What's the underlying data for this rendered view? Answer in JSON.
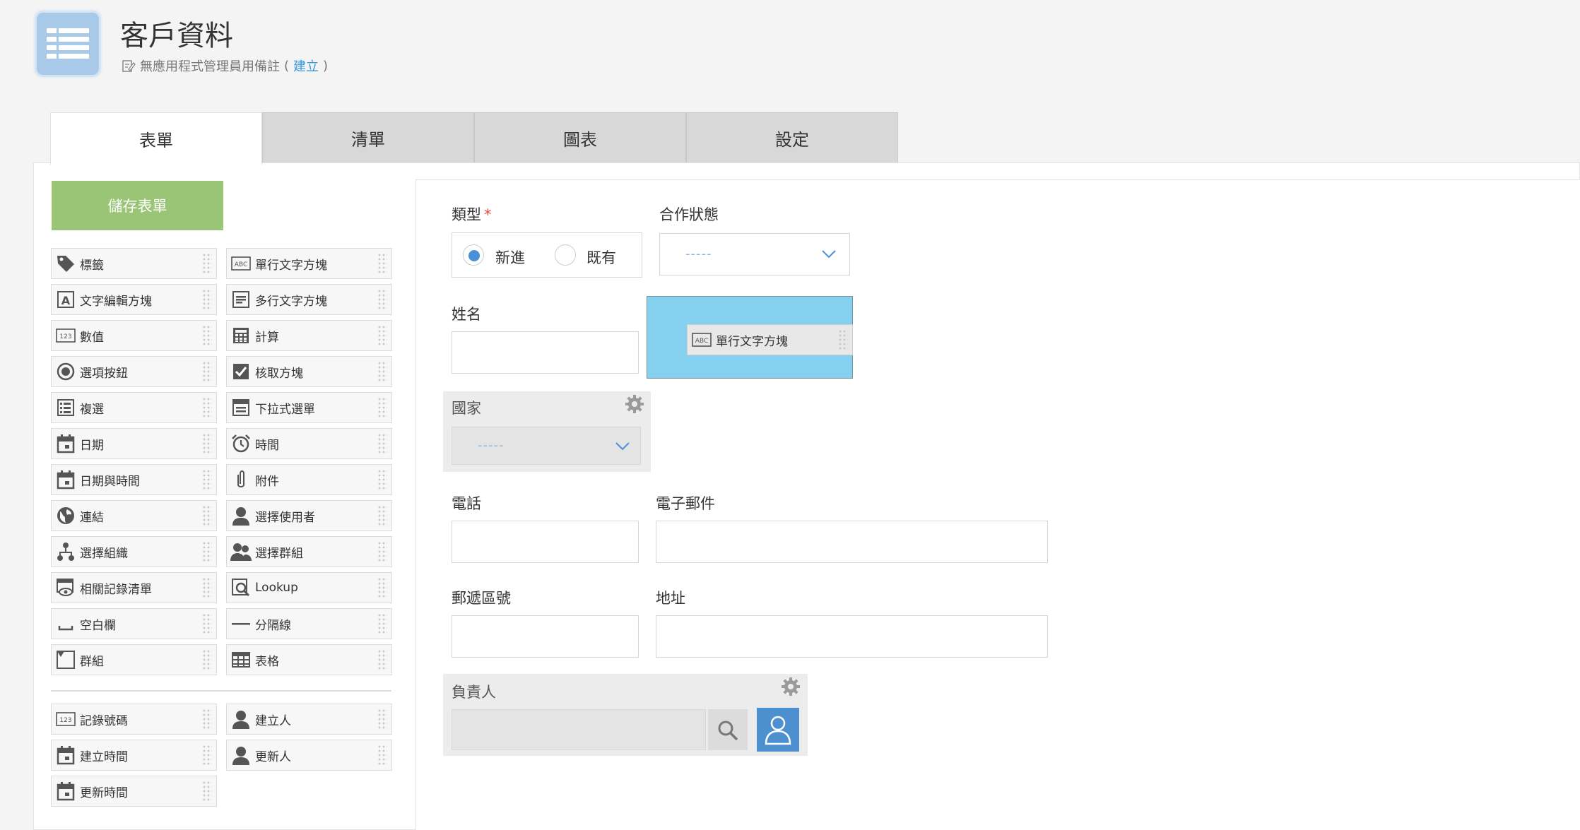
{
  "header": {
    "app_title": "客戶資料",
    "memo_text": "無應用程式管理員用備註",
    "memo_paren_open": "(",
    "memo_link": "建立",
    "memo_paren_close": ")"
  },
  "tabs": [
    {
      "label": "表單",
      "active": true
    },
    {
      "label": "清單",
      "active": false
    },
    {
      "label": "圖表",
      "active": false
    },
    {
      "label": "設定",
      "active": false
    }
  ],
  "save_button": "儲存表單",
  "palette": {
    "fields": [
      {
        "label": "標籤",
        "icon": "tag-icon"
      },
      {
        "label": "單行文字方塊",
        "icon": "abc-icon"
      },
      {
        "label": "文字編輯方塊",
        "icon": "rich-text-icon"
      },
      {
        "label": "多行文字方塊",
        "icon": "multiline-icon"
      },
      {
        "label": "數值",
        "icon": "number-icon"
      },
      {
        "label": "計算",
        "icon": "calculator-icon"
      },
      {
        "label": "選項按鈕",
        "icon": "radio-icon"
      },
      {
        "label": "核取方塊",
        "icon": "checkbox-icon"
      },
      {
        "label": "複選",
        "icon": "multi-select-icon"
      },
      {
        "label": "下拉式選單",
        "icon": "dropdown-icon"
      },
      {
        "label": "日期",
        "icon": "calendar-icon"
      },
      {
        "label": "時間",
        "icon": "alarm-clock-icon"
      },
      {
        "label": "日期與時間",
        "icon": "calendar-icon"
      },
      {
        "label": "附件",
        "icon": "paperclip-icon"
      },
      {
        "label": "連結",
        "icon": "globe-icon"
      },
      {
        "label": "選擇使用者",
        "icon": "user-icon"
      },
      {
        "label": "選擇組織",
        "icon": "org-icon"
      },
      {
        "label": "選擇群組",
        "icon": "group-icon"
      },
      {
        "label": "相關記錄清單",
        "icon": "related-records-icon"
      },
      {
        "label": "Lookup",
        "icon": "lookup-icon"
      },
      {
        "label": "空白欄",
        "icon": "blank-space-icon"
      },
      {
        "label": "分隔線",
        "icon": "divider-icon"
      },
      {
        "label": "群組",
        "icon": "group-field-icon"
      },
      {
        "label": "表格",
        "icon": "table-icon"
      }
    ],
    "system_fields": [
      {
        "label": "記錄號碼",
        "icon": "number-icon"
      },
      {
        "label": "建立人",
        "icon": "user-icon"
      },
      {
        "label": "建立時間",
        "icon": "calendar-icon"
      },
      {
        "label": "更新人",
        "icon": "user-icon"
      },
      {
        "label": "更新時間",
        "icon": "calendar-icon"
      }
    ]
  },
  "form": {
    "type_label": "類型",
    "type_required": "*",
    "type_options": [
      "新進",
      "既有"
    ],
    "type_selected": "新進",
    "status_label": "合作狀態",
    "status_value": "-----",
    "name_label": "姓名",
    "drag_item_label": "單行文字方塊",
    "country_label": "國家",
    "country_value": "-----",
    "phone_label": "電話",
    "email_label": "電子郵件",
    "zip_label": "郵遞區號",
    "address_label": "地址",
    "owner_label": "負責人"
  },
  "colors": {
    "accent_blue": "#4a90d9",
    "save_green": "#9ac576",
    "drop_zone": "#86d0ef",
    "required_red": "#e74c3c",
    "link_blue": "#3498db"
  }
}
